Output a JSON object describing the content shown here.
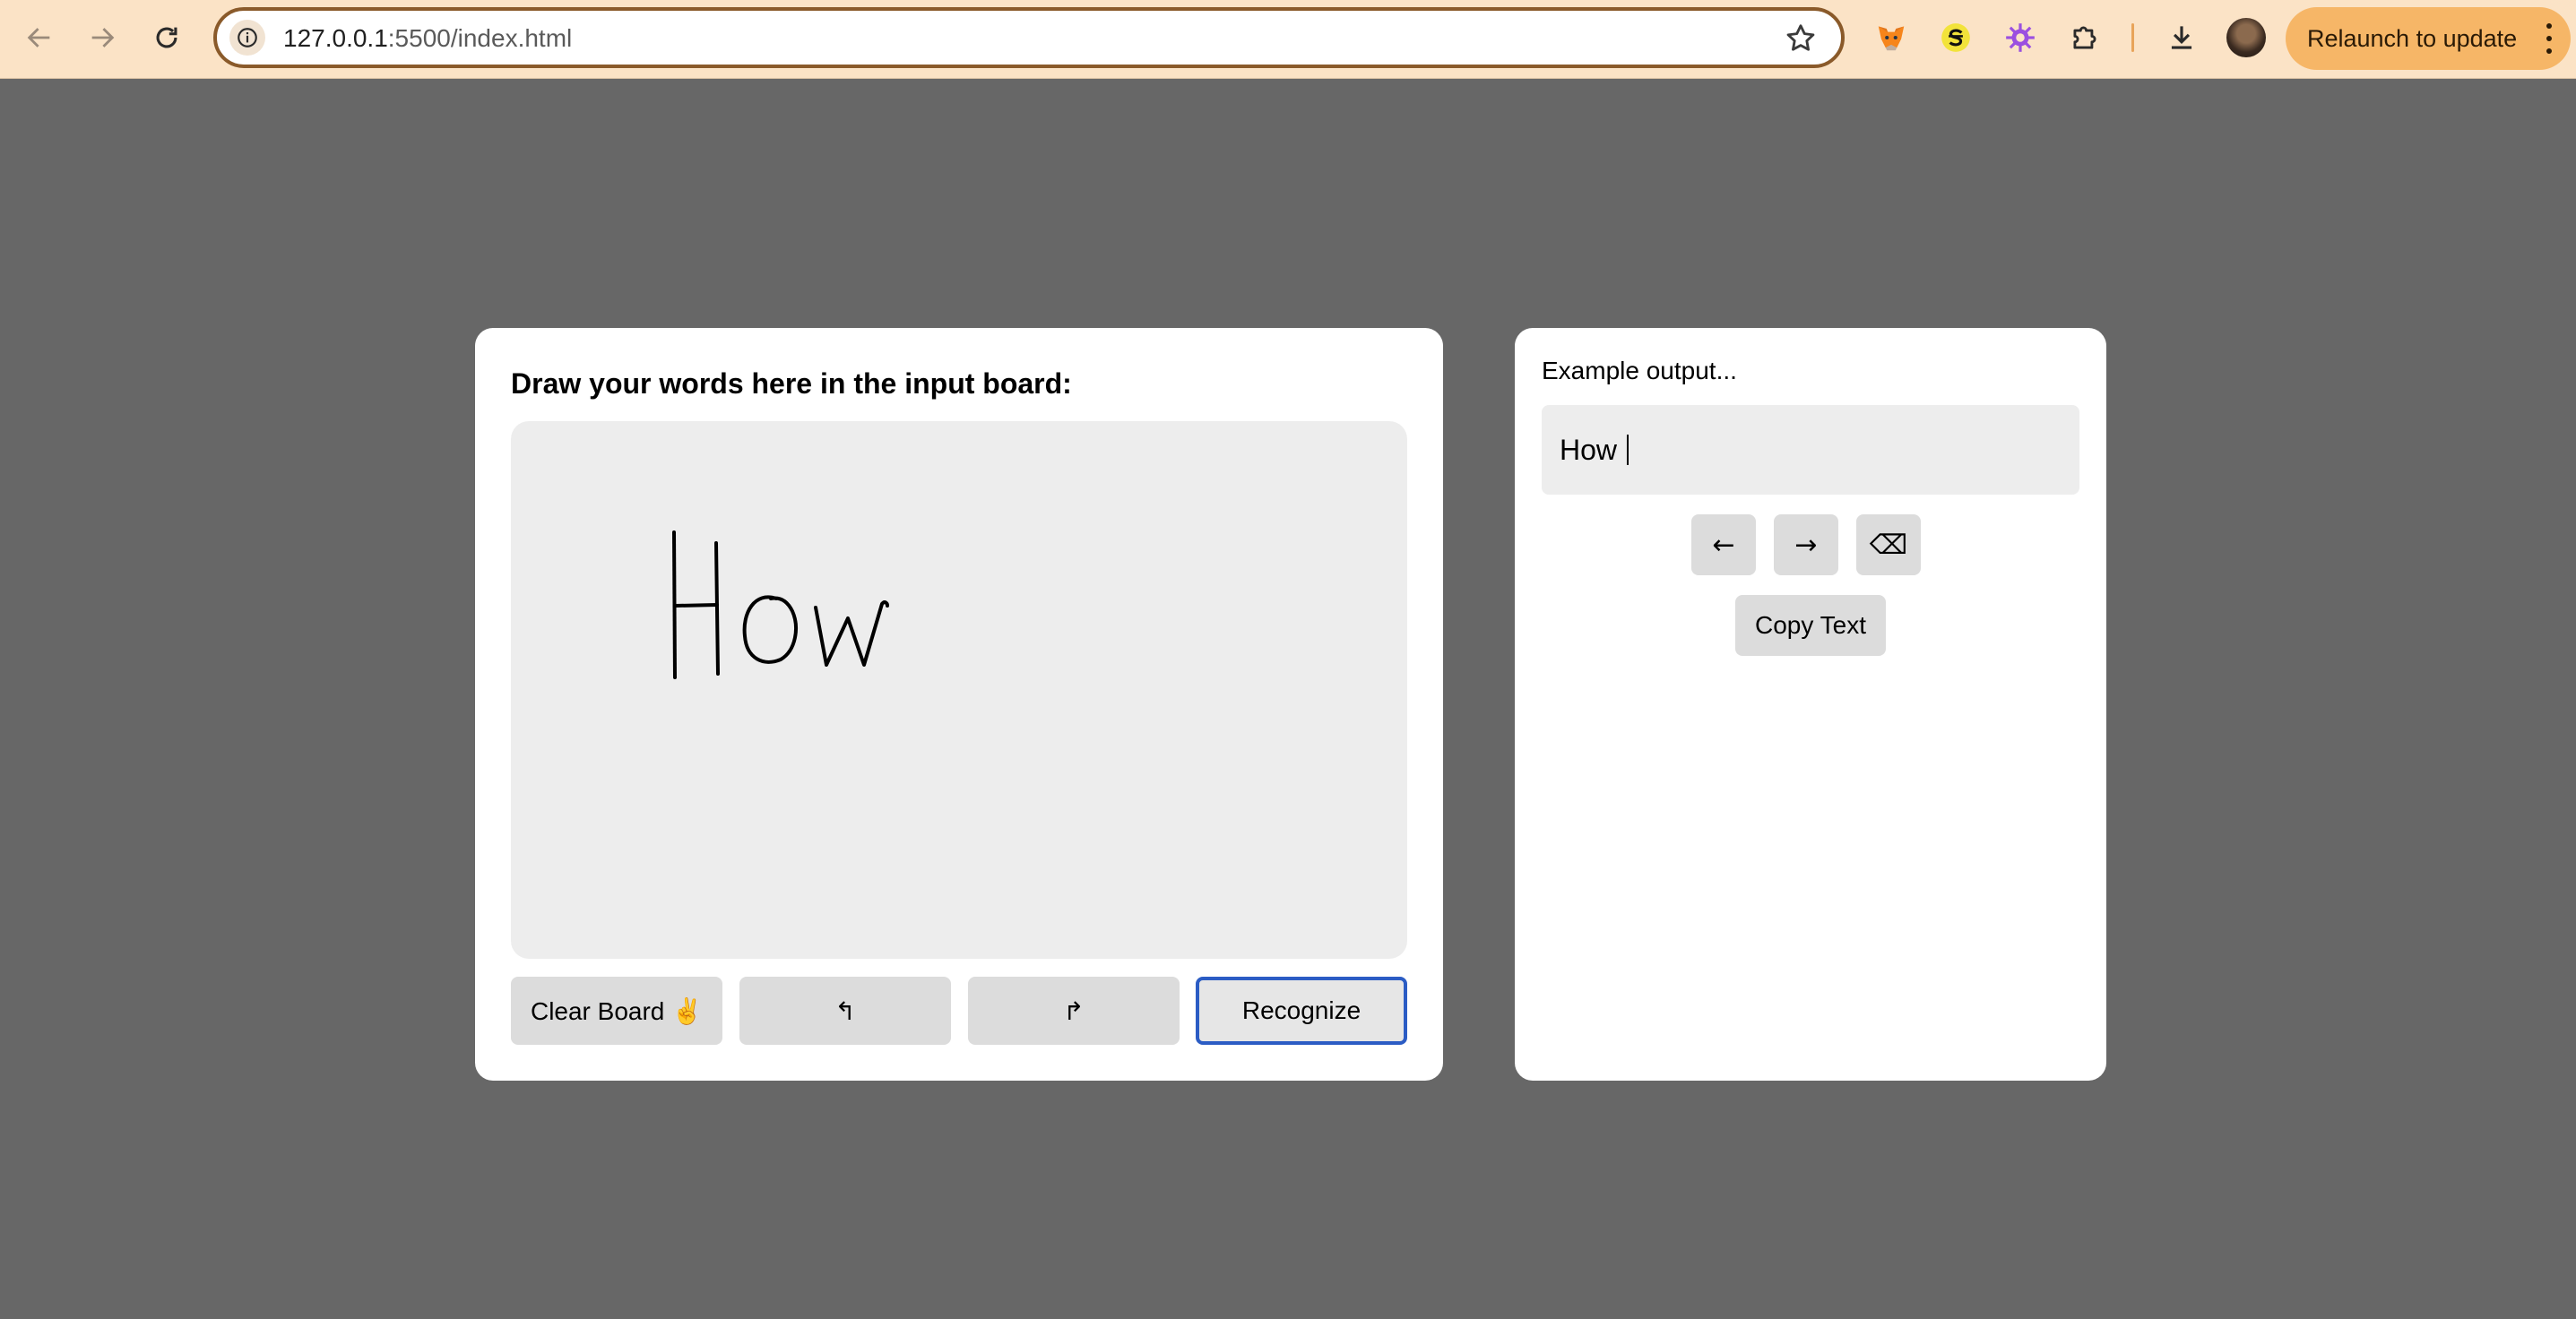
{
  "browser": {
    "url_host": "127.0.0.1",
    "url_rest": ":5500/index.html",
    "relaunch_label": "Relaunch to update",
    "toolbar_icons": [
      "back-arrow-icon",
      "forward-arrow-icon",
      "reload-icon",
      "site-info-icon",
      "bookmark-star-icon",
      "metamask-fox-icon",
      "yellow-s-extension-icon",
      "purple-gear-extension-icon",
      "puzzle-extensions-icon",
      "download-icon",
      "profile-avatar",
      "kebab-menu-icon"
    ],
    "colors": {
      "chrome_bg": "#fbe3c6",
      "omnibox_border": "#8a5a2a",
      "relaunch_bg": "#f6b667"
    }
  },
  "page": {
    "background": "#676767",
    "input_card": {
      "title": "Draw your words here in the input board:",
      "drawing_text": "How",
      "buttons": {
        "clear": "Clear Board ✌️",
        "undo": "↰",
        "redo": "↱",
        "recognize": "Recognize"
      },
      "accent_border": "#2b5cc4"
    },
    "output_card": {
      "label": "Example output...",
      "output_text": "How ",
      "buttons": {
        "left": "←",
        "right": "→",
        "backspace": "⌫",
        "copy": "Copy Text"
      }
    }
  }
}
